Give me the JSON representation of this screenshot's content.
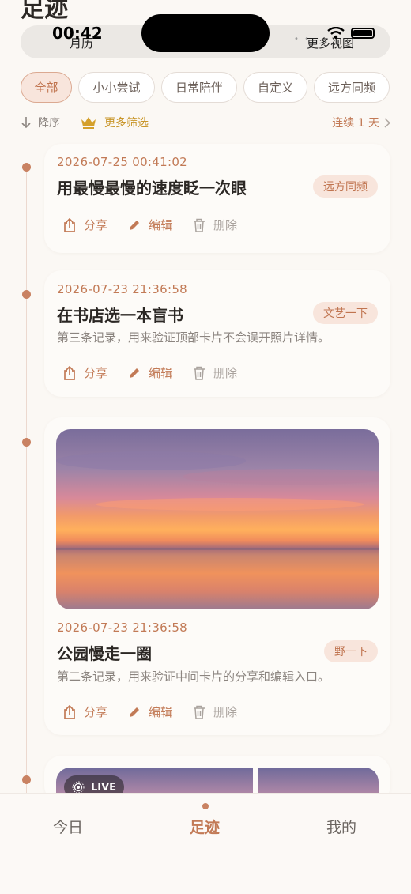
{
  "page": {
    "title": "足迹"
  },
  "status_bar": {
    "time": "00:42"
  },
  "segment": {
    "left": "月历",
    "right": "更多视图"
  },
  "chips": [
    "全部",
    "小小尝试",
    "日常陪伴",
    "自定义",
    "远方同频"
  ],
  "filters": {
    "sort": "降序",
    "more": "更多筛选",
    "streak": "连续 1 天"
  },
  "actions": {
    "share": "分享",
    "edit": "编辑",
    "delete": "删除"
  },
  "cards": [
    {
      "date": "2026-07-25 00:41:02",
      "title": "用最慢最慢的速度眨一次眼",
      "tag": "远方同频"
    },
    {
      "date": "2026-07-23 21:36:58",
      "title": "在书店选一本盲书",
      "desc": "第三条记录，用来验证顶部卡片不会误开照片详情。",
      "tag": "文艺一下"
    },
    {
      "date": "2026-07-23 21:36:58",
      "title": "公园慢走一圈",
      "desc": "第二条记录，用来验证中间卡片的分享和编辑入口。",
      "tag": "野一下"
    }
  ],
  "live_badge": "LIVE",
  "tabbar": {
    "today": "今日",
    "footprint": "足迹",
    "mine": "我的"
  },
  "colors": {
    "accent": "#c27a56",
    "chip_active_bg": "#f8e5dc",
    "gold": "#c9962a"
  }
}
